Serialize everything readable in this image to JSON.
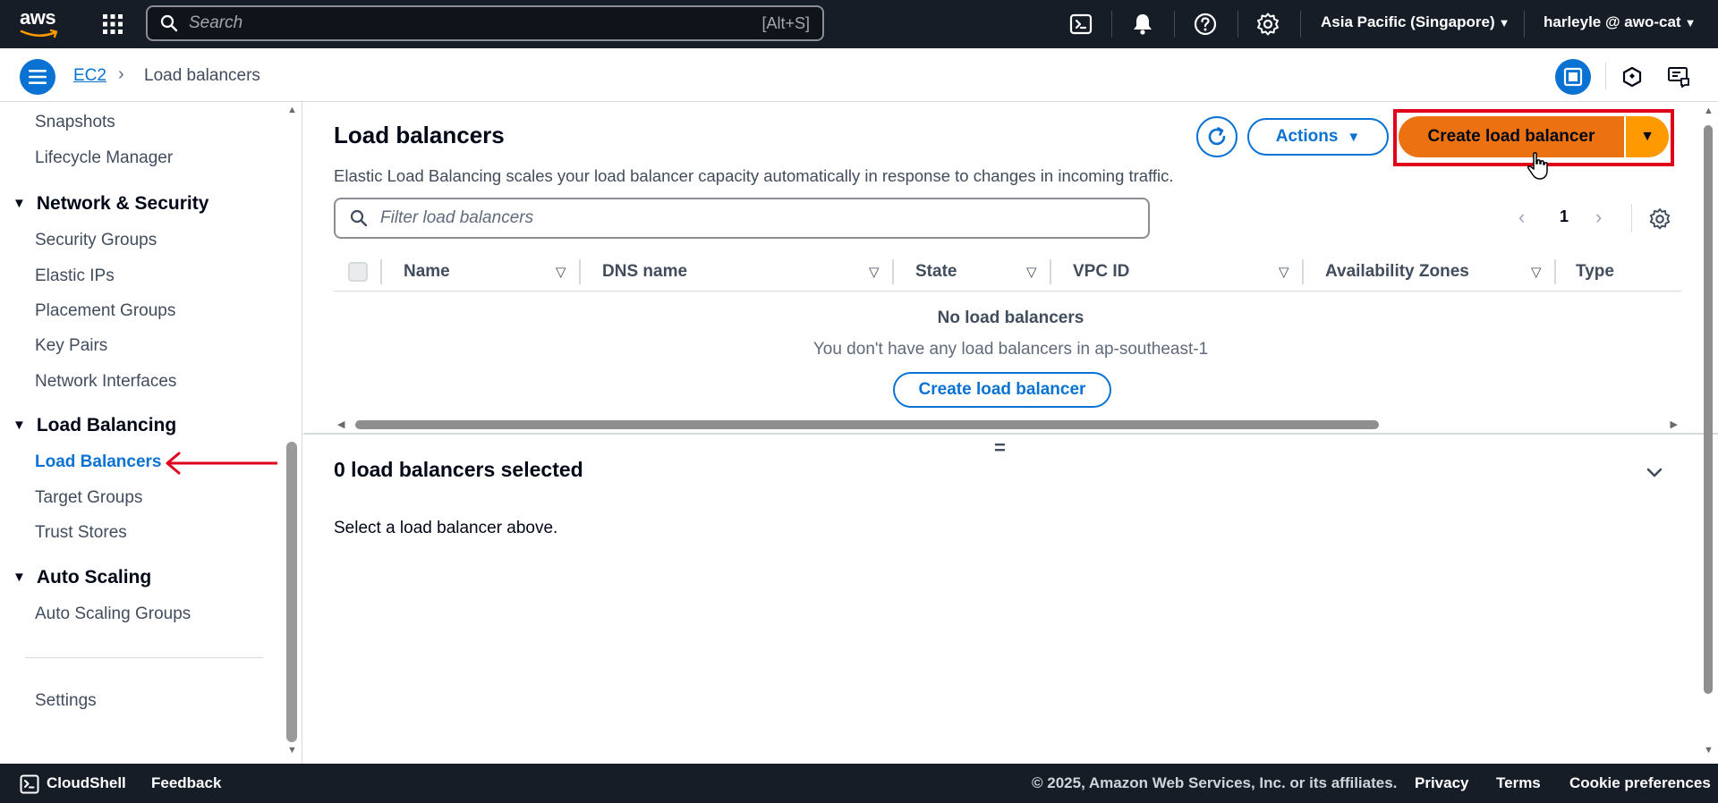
{
  "topnav": {
    "logo_text": "aws",
    "search_placeholder": "Search",
    "search_shortcut": "[Alt+S]",
    "icons": [
      "cloudshell-icon",
      "bell-icon",
      "help-icon",
      "gear-icon"
    ],
    "region": "Asia Pacific (Singapore)",
    "user": "harleyle @ awo-cat"
  },
  "breadcrumb": {
    "items": [
      "EC2",
      "Load balancers"
    ]
  },
  "sidebar": {
    "items_top": [
      "Snapshots",
      "Lifecycle Manager"
    ],
    "sections": [
      {
        "title": "Network & Security",
        "items": [
          "Security Groups",
          "Elastic IPs",
          "Placement Groups",
          "Key Pairs",
          "Network Interfaces"
        ]
      },
      {
        "title": "Load Balancing",
        "items": [
          "Load Balancers",
          "Target Groups",
          "Trust Stores"
        ]
      },
      {
        "title": "Auto Scaling",
        "items": [
          "Auto Scaling Groups"
        ]
      }
    ],
    "active_item": "Load Balancers",
    "settings": "Settings"
  },
  "main": {
    "title": "Load balancers",
    "description": "Elastic Load Balancing scales your load balancer capacity automatically in response to changes in incoming traffic.",
    "actions_label": "Actions",
    "create_label": "Create load balancer",
    "filter_placeholder": "Filter load balancers",
    "page_number": "1",
    "columns": [
      "Name",
      "DNS name",
      "State",
      "VPC ID",
      "Availability Zones",
      "Type"
    ],
    "empty_title": "No load balancers",
    "empty_desc": "You don't have any load balancers in ap-southeast-1",
    "empty_button": "Create load balancer",
    "split_handle": "=",
    "selected_title": "0 load balancers selected",
    "selected_desc": "Select a load balancer above."
  },
  "footer": {
    "cloudshell": "CloudShell",
    "feedback": "Feedback",
    "copyright": "© 2025, Amazon Web Services, Inc. or its affiliates.",
    "privacy": "Privacy",
    "terms": "Terms",
    "cookies": "Cookie preferences"
  },
  "colors": {
    "nav_bg": "#161d26",
    "link_blue": "#0972d3",
    "primary_orange": "#ec7211",
    "split_orange": "#ff9900",
    "highlight_red": "#e1001b"
  }
}
